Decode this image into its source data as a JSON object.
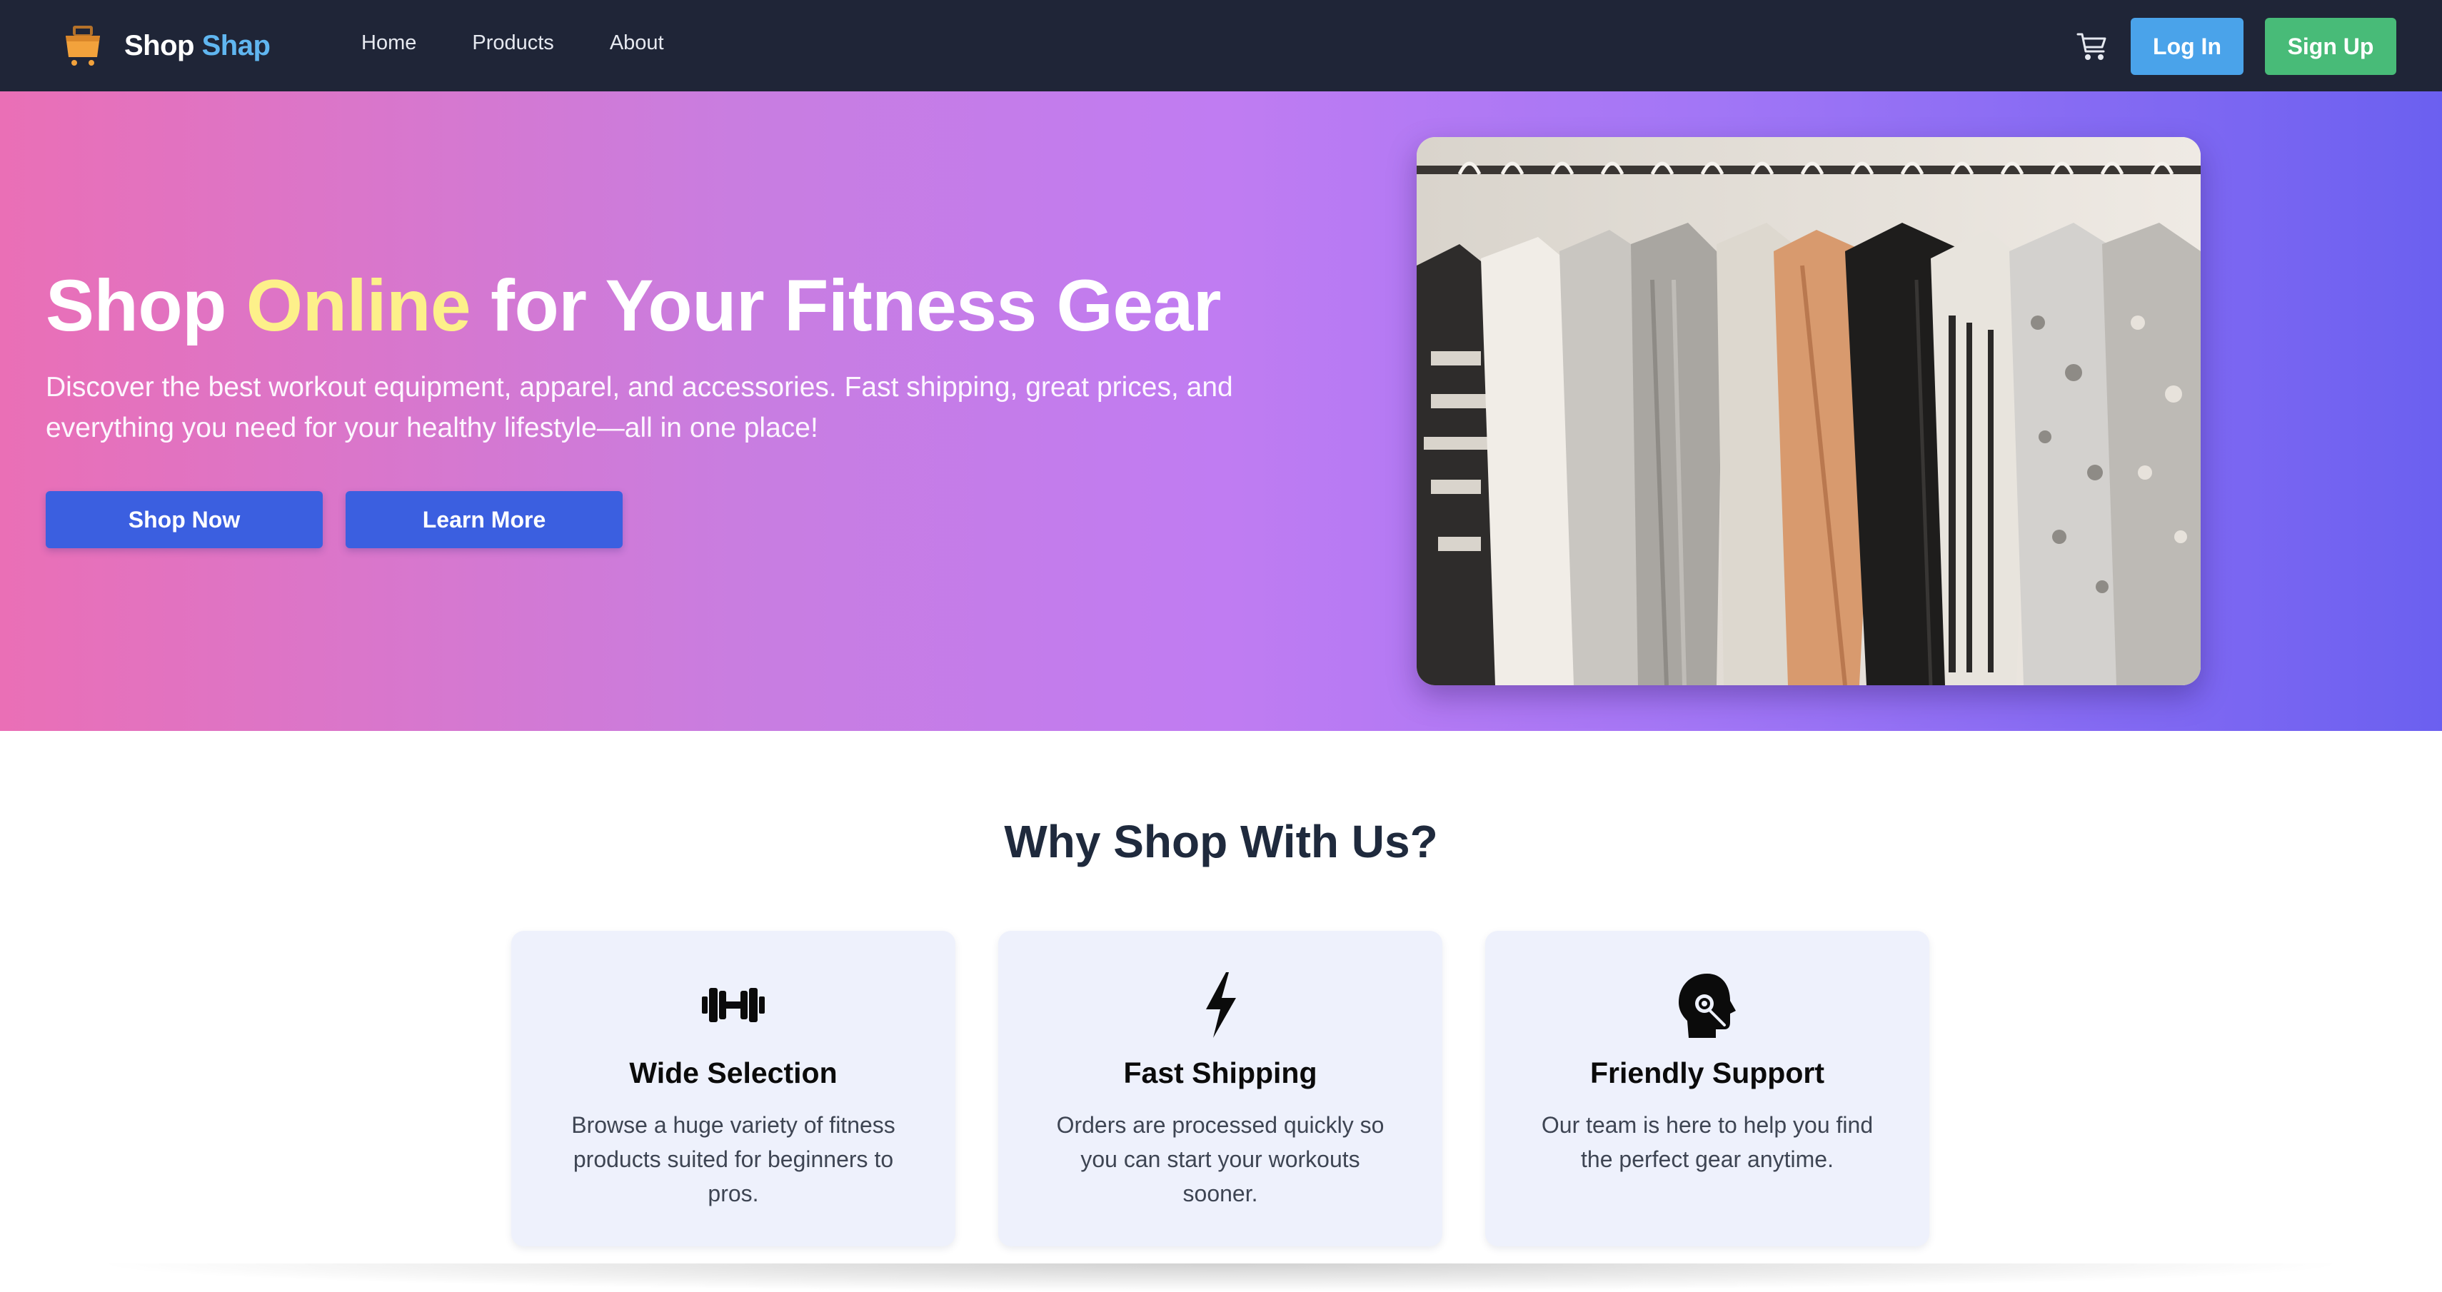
{
  "navbar": {
    "brand": {
      "part1": "Shop",
      "part2": "Shap",
      "logo_icon": "shopping-basket-icon"
    },
    "links": [
      "Home",
      "Products",
      "About"
    ],
    "cart_icon": "shopping-cart-icon",
    "login_label": "Log In",
    "signup_label": "Sign Up"
  },
  "hero": {
    "title_before": "Shop ",
    "title_highlight": "Online",
    "title_after": " for Your Fitness Gear",
    "subtitle": "Discover the best workout equipment, apparel, and accessories. Fast shipping, great prices, and everything you need for your healthy lifestyle—all in one place!",
    "shop_now_label": "Shop Now",
    "learn_more_label": "Learn More",
    "image_icon": "clothing-rack-photo"
  },
  "why": {
    "title": "Why Shop With Us?",
    "cards": [
      {
        "icon": "dumbbell-icon",
        "title": "Wide Selection",
        "text": "Browse a huge variety of fitness products suited for beginners to pros."
      },
      {
        "icon": "lightning-bolt-icon",
        "title": "Fast Shipping",
        "text": "Orders are processed quickly so you can start your workouts sooner."
      },
      {
        "icon": "headset-support-icon",
        "title": "Friendly Support",
        "text": "Our team is here to help you find the perfect gear anytime."
      }
    ]
  },
  "colors": {
    "navbar_bg": "#1f2537",
    "brand_accent": "#60b6f0",
    "login_bg": "#4aa3ea",
    "signup_bg": "#48bb78",
    "hero_gradient_start": "#ea6fb6",
    "hero_gradient_end": "#6b60f0",
    "highlight": "#fdf08a",
    "hero_button_bg": "#3b5fe0",
    "card_bg": "#eef1fc"
  }
}
